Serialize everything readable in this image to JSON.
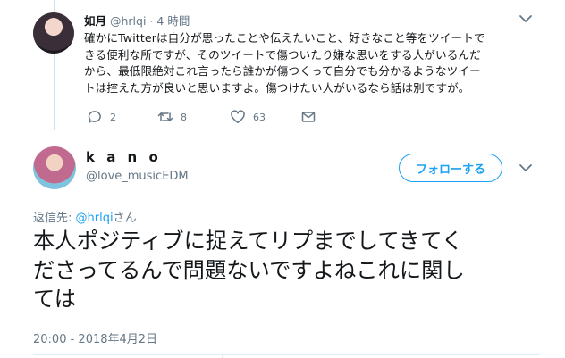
{
  "reply_tweet": {
    "author_name": "如月",
    "author_handle": "@hrlqi",
    "separator": "·",
    "time_ago": "4 時間",
    "body_lines": [
      "確かにTwitterは自分が思ったことや伝えたいこと、好きなこと等をツイートで",
      "きる便利な所ですが、そのツイートで傷ついたり嫌な思いをする人がいるんだ",
      "から、最低限絶対これ言ったら誰かが傷つくって自分でも分かるようなツイー",
      "トは控えた方が良いと思いますよ。傷つけたい人がいるなら話は別ですが。"
    ],
    "actions": {
      "reply_count": "2",
      "retweet_count": "8",
      "like_count": "63"
    }
  },
  "main_tweet": {
    "author_name": "k a n o",
    "author_handle": "@love_musicEDM",
    "follow_label": "フォローする",
    "reply_to_prefix": "返信先: ",
    "reply_to_handle": "@hrlqi",
    "reply_to_suffix": "さん",
    "text_lines": [
      "本人ポジティブに捉えてリプまでしてきてく",
      "ださってるんで問題ないですよねこれに関し",
      "ては"
    ],
    "timestamp": "20:00 - 2018年4月2日"
  },
  "colors": {
    "accent": "#1da1f2",
    "muted": "#657786",
    "thread_line": "#cce3ef",
    "text": "#14171a"
  }
}
